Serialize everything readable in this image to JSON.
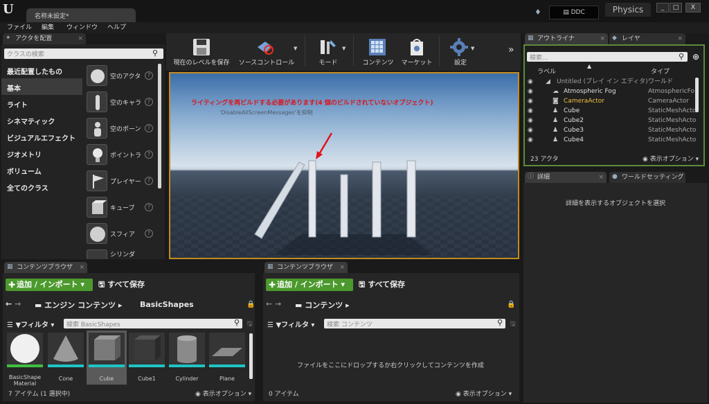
{
  "window": {
    "doc_tab": "名称未設定*",
    "ddc_label": "DDC",
    "physics_tab": "Physics",
    "controls": [
      "_",
      "□",
      "X"
    ]
  },
  "menu": [
    "ファイル",
    "編集",
    "ウィンドウ",
    "ヘルプ"
  ],
  "place_actors": {
    "tab": "アクタを配置",
    "search_placeholder": "クラスの検索",
    "categories": [
      "最近配置したもの",
      "基本",
      "ライト",
      "シネマティック",
      "ビジュアルエフェクト",
      "ジオメトリ",
      "ボリューム",
      "全てのクラス"
    ],
    "selected_category": "基本",
    "assets": [
      "空のアクタ",
      "空のキャラ",
      "空のポーン",
      "ポイントラ",
      "プレイヤー",
      "キューブ",
      "スフィア",
      "シリンダ"
    ]
  },
  "toolbar": {
    "buttons": [
      "現在のレベルを保存",
      "ソースコントロール",
      "モード",
      "コンテンツ",
      "マーケット",
      "設定"
    ],
    "more": "»"
  },
  "viewport": {
    "warning": "ライティングを再ビルドする必要があります(4 個のビルドされていないオブジェクト)",
    "suppress": "'DisableAllScreenMessages'を抑制"
  },
  "outliner": {
    "tab": "アウトライナ",
    "tab2": "レイヤ",
    "search_placeholder": "検索...",
    "col_label": "ラベル",
    "col_type": "タイプ",
    "rows": [
      {
        "name": "Untitled (プレイ イン エディタ)",
        "type": "ワールド"
      },
      {
        "name": "Atmospheric Fog",
        "type": "AtmosphericFo"
      },
      {
        "name": "CameraActor",
        "type": "CameraActor"
      },
      {
        "name": "Cube",
        "type": "StaticMeshActo"
      },
      {
        "name": "Cube2",
        "type": "StaticMeshActo"
      },
      {
        "name": "Cube3",
        "type": "StaticMeshActo"
      },
      {
        "name": "Cube4",
        "type": "StaticMeshActo"
      }
    ],
    "count": "23 アクタ",
    "view_options": "表示オプション"
  },
  "details": {
    "tab": "詳細",
    "tab2": "ワールドセッティング",
    "message": "詳細を表示するオブジェクトを選択"
  },
  "cb1": {
    "tab": "コンテンツブラウザ",
    "add": "追加 / インポート",
    "save_all": "すべて保存",
    "path_root": "エンジン コンテンツ",
    "path_leaf": "BasicShapes",
    "filter": "フィルタ",
    "search_placeholder": "検索 BasicShapes",
    "assets": [
      "BasicShape Material",
      "Cone",
      "Cube",
      "Cube1",
      "Cylinder",
      "Plane"
    ],
    "footer": "7 アイテム (1 選択中)",
    "view_options": "表示オプション"
  },
  "cb2": {
    "tab": "コンテンツブラウザ",
    "add": "追加 / インポート",
    "save_all": "すべて保存",
    "path_root": "コンテンツ",
    "filter": "フィルタ",
    "search_placeholder": "検索 コンテンツ",
    "empty_message": "ファイルをここにドロップするか右クリックしてコンテンツを作成",
    "footer": "0 アイテム",
    "view_options": "表示オプション"
  },
  "colors": {
    "accent_green": "#4c9a2e",
    "viewport_border": "#c58a1f",
    "warning_red": "#e0141b",
    "outliner_border": "#5c8c3a",
    "selected_actor": "#f0c040"
  }
}
